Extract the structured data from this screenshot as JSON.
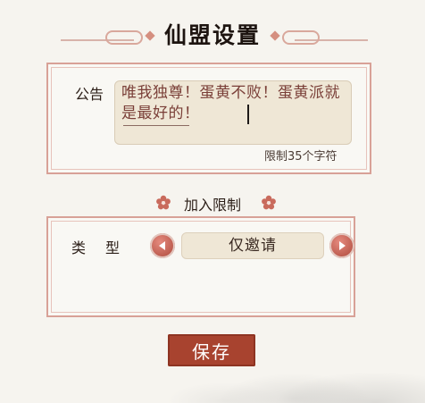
{
  "title": "仙盟设置",
  "notice": {
    "label": "公告",
    "text": "唯我独尊！蛋黄不败！蛋黄派就是最好的！",
    "limit": "限制35个字符"
  },
  "join_limit": {
    "title": "加入限制",
    "type_label": "类型",
    "type_value": "仅邀请"
  },
  "save_label": "保存",
  "colors": {
    "accent": "#a8432f",
    "border": "#d8a197",
    "field_bg": "#efe7d6"
  }
}
